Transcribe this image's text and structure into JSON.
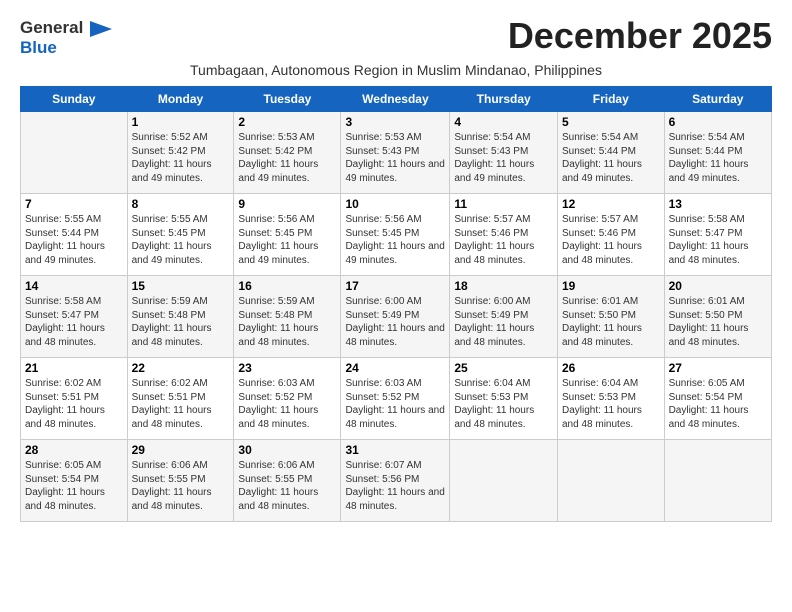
{
  "header": {
    "logo_general": "General",
    "logo_blue": "Blue",
    "month_title": "December 2025",
    "subtitle": "Tumbagaan, Autonomous Region in Muslim Mindanao, Philippines"
  },
  "calendar": {
    "weekdays": [
      "Sunday",
      "Monday",
      "Tuesday",
      "Wednesday",
      "Thursday",
      "Friday",
      "Saturday"
    ],
    "rows": [
      [
        {
          "day": "",
          "info": ""
        },
        {
          "day": "1",
          "info": "Sunrise: 5:52 AM\nSunset: 5:42 PM\nDaylight: 11 hours\nand 49 minutes."
        },
        {
          "day": "2",
          "info": "Sunrise: 5:53 AM\nSunset: 5:42 PM\nDaylight: 11 hours\nand 49 minutes."
        },
        {
          "day": "3",
          "info": "Sunrise: 5:53 AM\nSunset: 5:43 PM\nDaylight: 11 hours\nand 49 minutes."
        },
        {
          "day": "4",
          "info": "Sunrise: 5:54 AM\nSunset: 5:43 PM\nDaylight: 11 hours\nand 49 minutes."
        },
        {
          "day": "5",
          "info": "Sunrise: 5:54 AM\nSunset: 5:44 PM\nDaylight: 11 hours\nand 49 minutes."
        },
        {
          "day": "6",
          "info": "Sunrise: 5:54 AM\nSunset: 5:44 PM\nDaylight: 11 hours\nand 49 minutes."
        }
      ],
      [
        {
          "day": "7",
          "info": "Sunrise: 5:55 AM\nSunset: 5:44 PM\nDaylight: 11 hours\nand 49 minutes."
        },
        {
          "day": "8",
          "info": "Sunrise: 5:55 AM\nSunset: 5:45 PM\nDaylight: 11 hours\nand 49 minutes."
        },
        {
          "day": "9",
          "info": "Sunrise: 5:56 AM\nSunset: 5:45 PM\nDaylight: 11 hours\nand 49 minutes."
        },
        {
          "day": "10",
          "info": "Sunrise: 5:56 AM\nSunset: 5:45 PM\nDaylight: 11 hours\nand 49 minutes."
        },
        {
          "day": "11",
          "info": "Sunrise: 5:57 AM\nSunset: 5:46 PM\nDaylight: 11 hours\nand 48 minutes."
        },
        {
          "day": "12",
          "info": "Sunrise: 5:57 AM\nSunset: 5:46 PM\nDaylight: 11 hours\nand 48 minutes."
        },
        {
          "day": "13",
          "info": "Sunrise: 5:58 AM\nSunset: 5:47 PM\nDaylight: 11 hours\nand 48 minutes."
        }
      ],
      [
        {
          "day": "14",
          "info": "Sunrise: 5:58 AM\nSunset: 5:47 PM\nDaylight: 11 hours\nand 48 minutes."
        },
        {
          "day": "15",
          "info": "Sunrise: 5:59 AM\nSunset: 5:48 PM\nDaylight: 11 hours\nand 48 minutes."
        },
        {
          "day": "16",
          "info": "Sunrise: 5:59 AM\nSunset: 5:48 PM\nDaylight: 11 hours\nand 48 minutes."
        },
        {
          "day": "17",
          "info": "Sunrise: 6:00 AM\nSunset: 5:49 PM\nDaylight: 11 hours\nand 48 minutes."
        },
        {
          "day": "18",
          "info": "Sunrise: 6:00 AM\nSunset: 5:49 PM\nDaylight: 11 hours\nand 48 minutes."
        },
        {
          "day": "19",
          "info": "Sunrise: 6:01 AM\nSunset: 5:50 PM\nDaylight: 11 hours\nand 48 minutes."
        },
        {
          "day": "20",
          "info": "Sunrise: 6:01 AM\nSunset: 5:50 PM\nDaylight: 11 hours\nand 48 minutes."
        }
      ],
      [
        {
          "day": "21",
          "info": "Sunrise: 6:02 AM\nSunset: 5:51 PM\nDaylight: 11 hours\nand 48 minutes."
        },
        {
          "day": "22",
          "info": "Sunrise: 6:02 AM\nSunset: 5:51 PM\nDaylight: 11 hours\nand 48 minutes."
        },
        {
          "day": "23",
          "info": "Sunrise: 6:03 AM\nSunset: 5:52 PM\nDaylight: 11 hours\nand 48 minutes."
        },
        {
          "day": "24",
          "info": "Sunrise: 6:03 AM\nSunset: 5:52 PM\nDaylight: 11 hours\nand 48 minutes."
        },
        {
          "day": "25",
          "info": "Sunrise: 6:04 AM\nSunset: 5:53 PM\nDaylight: 11 hours\nand 48 minutes."
        },
        {
          "day": "26",
          "info": "Sunrise: 6:04 AM\nSunset: 5:53 PM\nDaylight: 11 hours\nand 48 minutes."
        },
        {
          "day": "27",
          "info": "Sunrise: 6:05 AM\nSunset: 5:54 PM\nDaylight: 11 hours\nand 48 minutes."
        }
      ],
      [
        {
          "day": "28",
          "info": "Sunrise: 6:05 AM\nSunset: 5:54 PM\nDaylight: 11 hours\nand 48 minutes."
        },
        {
          "day": "29",
          "info": "Sunrise: 6:06 AM\nSunset: 5:55 PM\nDaylight: 11 hours\nand 48 minutes."
        },
        {
          "day": "30",
          "info": "Sunrise: 6:06 AM\nSunset: 5:55 PM\nDaylight: 11 hours\nand 48 minutes."
        },
        {
          "day": "31",
          "info": "Sunrise: 6:07 AM\nSunset: 5:56 PM\nDaylight: 11 hours\nand 48 minutes."
        },
        {
          "day": "",
          "info": ""
        },
        {
          "day": "",
          "info": ""
        },
        {
          "day": "",
          "info": ""
        }
      ]
    ]
  }
}
